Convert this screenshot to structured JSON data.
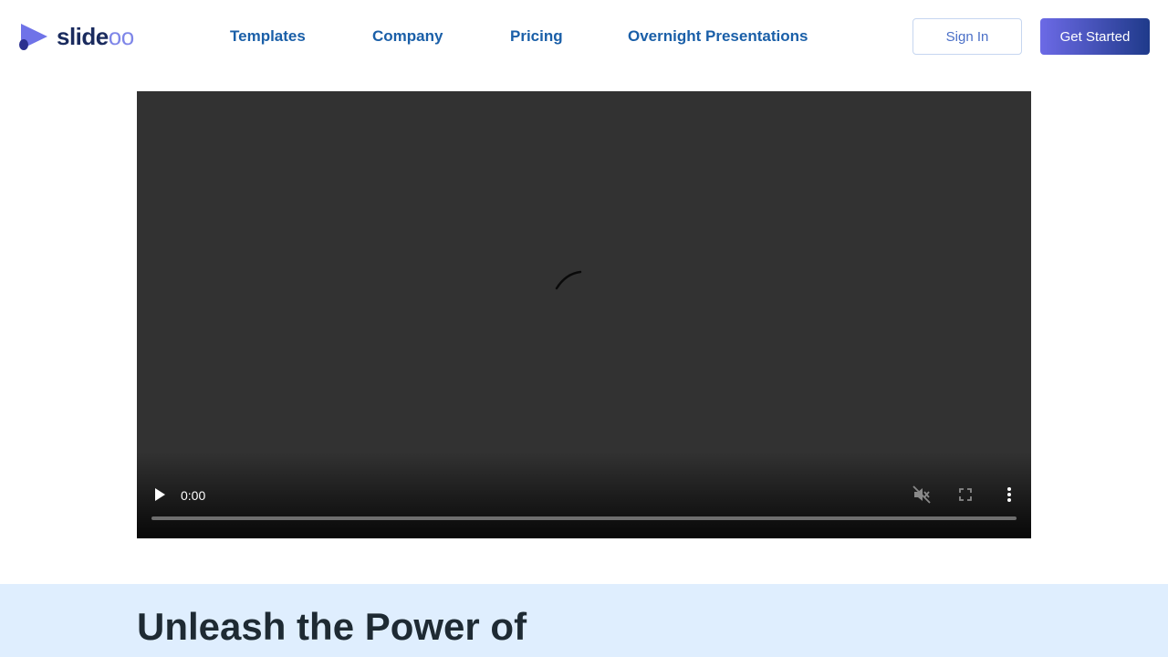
{
  "brand": {
    "name_part1": "slide",
    "name_part2": "oo",
    "colors": {
      "dark": "#1a2b5e",
      "accent": "#7e86e8"
    }
  },
  "nav": {
    "items": [
      {
        "label": "Templates"
      },
      {
        "label": "Company"
      },
      {
        "label": "Pricing"
      },
      {
        "label": "Overnight Presentations"
      }
    ],
    "color": "#1a5fa8"
  },
  "auth": {
    "sign_in_label": "Sign In",
    "get_started_label": "Get Started"
  },
  "video": {
    "current_time": "0:00",
    "state": "loading",
    "muted": true,
    "progress_fraction": 0,
    "icons": [
      "play-icon",
      "muted-speaker-icon",
      "fullscreen-icon",
      "more-vertical-icon",
      "loading-spinner-icon"
    ]
  },
  "hero": {
    "title": "Unleash the Power of",
    "background": "#dfeefe"
  }
}
